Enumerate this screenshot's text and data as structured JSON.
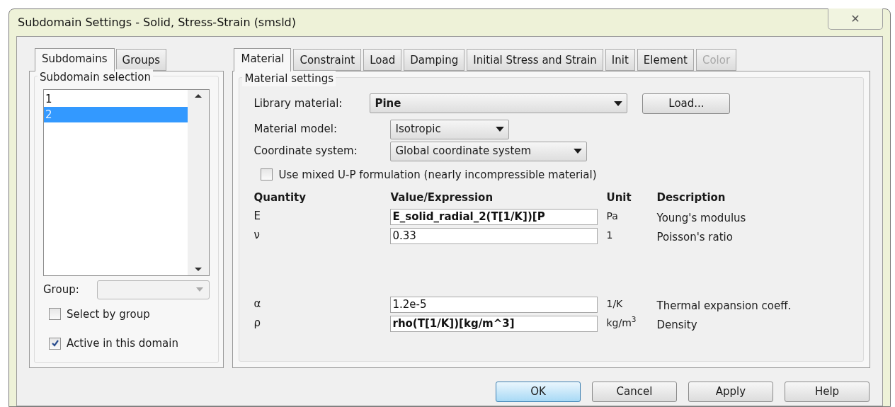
{
  "window": {
    "title": "Subdomain Settings - Solid, Stress-Strain (smsld)",
    "close": "✕"
  },
  "left_tabs": [
    {
      "label": "Subdomains",
      "selected": true
    },
    {
      "label": "Groups",
      "selected": false
    }
  ],
  "subdomain_selection": {
    "title": "Subdomain selection",
    "items": [
      {
        "label": "1",
        "selected": false
      },
      {
        "label": "2",
        "selected": true
      }
    ],
    "group_label": "Group:",
    "checkboxes": [
      {
        "label": "Select by group",
        "checked": false
      },
      {
        "label": "Active in this domain",
        "checked": true
      }
    ]
  },
  "right_tabs": [
    {
      "label": "Material",
      "selected": true,
      "disabled": false
    },
    {
      "label": "Constraint",
      "selected": false,
      "disabled": false
    },
    {
      "label": "Load",
      "selected": false,
      "disabled": false
    },
    {
      "label": "Damping",
      "selected": false,
      "disabled": false
    },
    {
      "label": "Initial Stress and Strain",
      "selected": false,
      "disabled": false
    },
    {
      "label": "Init",
      "selected": false,
      "disabled": false
    },
    {
      "label": "Element",
      "selected": false,
      "disabled": false
    },
    {
      "label": "Color",
      "selected": false,
      "disabled": true
    }
  ],
  "material_settings": {
    "title": "Material settings",
    "library_label": "Library material:",
    "library_value": "Pine",
    "load_button": "Load...",
    "model_label": "Material model:",
    "model_value": "Isotropic",
    "coord_label": "Coordinate system:",
    "coord_value": "Global coordinate system",
    "mixed_up": {
      "label": "Use mixed U-P formulation (nearly incompressible material)",
      "checked": false
    },
    "columns": [
      "Quantity",
      "Value/Expression",
      "Unit",
      "Description"
    ],
    "rows": [
      {
        "quantity": "E",
        "value": "E_solid_radial_2(T[1/K])[P",
        "bold": true,
        "unit": "Pa",
        "description": "Young's modulus"
      },
      {
        "quantity": "ν",
        "value": "0.33",
        "bold": false,
        "unit": "1",
        "description": "Poisson's ratio"
      },
      {
        "quantity": "α",
        "value": "1.2e-5",
        "bold": false,
        "unit": "1/K",
        "description": "Thermal expansion coeff."
      },
      {
        "quantity": "ρ",
        "value": "rho(T[1/K])[kg/m^3]",
        "bold": true,
        "unit": "kg/m$^{3}$",
        "description": "Density"
      }
    ]
  },
  "buttons": [
    {
      "label": "OK",
      "kind": "default"
    },
    {
      "label": "Cancel",
      "kind": "normal"
    },
    {
      "label": "Apply",
      "kind": "normal"
    },
    {
      "label": "Help",
      "kind": "normal"
    }
  ]
}
